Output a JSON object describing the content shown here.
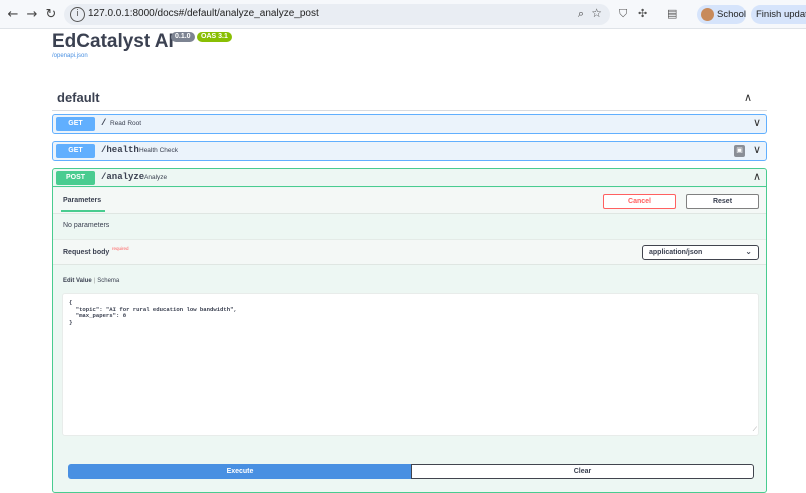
{
  "browser": {
    "url": "127.0.0.1:8000/docs#/default/analyze_analyze_post",
    "profile_label": "School",
    "finish_update_label": "Finish update"
  },
  "header": {
    "title": "EdCatalyst AI",
    "version_badge": "0.1.0",
    "oas_badge": "OAS 3.1",
    "openapi_link": "/openapi.json"
  },
  "section": {
    "title": "default"
  },
  "operations": [
    {
      "method": "GET",
      "path": "/",
      "summary": "Read Root"
    },
    {
      "method": "GET",
      "path": "/health",
      "summary": "Health Check"
    },
    {
      "method": "POST",
      "path": "/analyze",
      "summary": "Analyze"
    }
  ],
  "post_panel": {
    "parameters_tab": "Parameters",
    "cancel_label": "Cancel",
    "reset_label": "Reset",
    "no_parameters": "No parameters",
    "request_body_label": "Request body",
    "required_label": "required",
    "content_type": "application/json",
    "edit_value_tab": "Edit Value",
    "schema_tab": "Schema",
    "body": "{\n  \"topic\": \"AI for rural education low bandwidth\",\n  \"max_papers\": 8\n}",
    "execute_label": "Execute",
    "clear_label": "Clear"
  },
  "colors": {
    "get": "#61affe",
    "post": "#49cc90",
    "execute": "#4990e2",
    "cancel": "#ff6060"
  }
}
